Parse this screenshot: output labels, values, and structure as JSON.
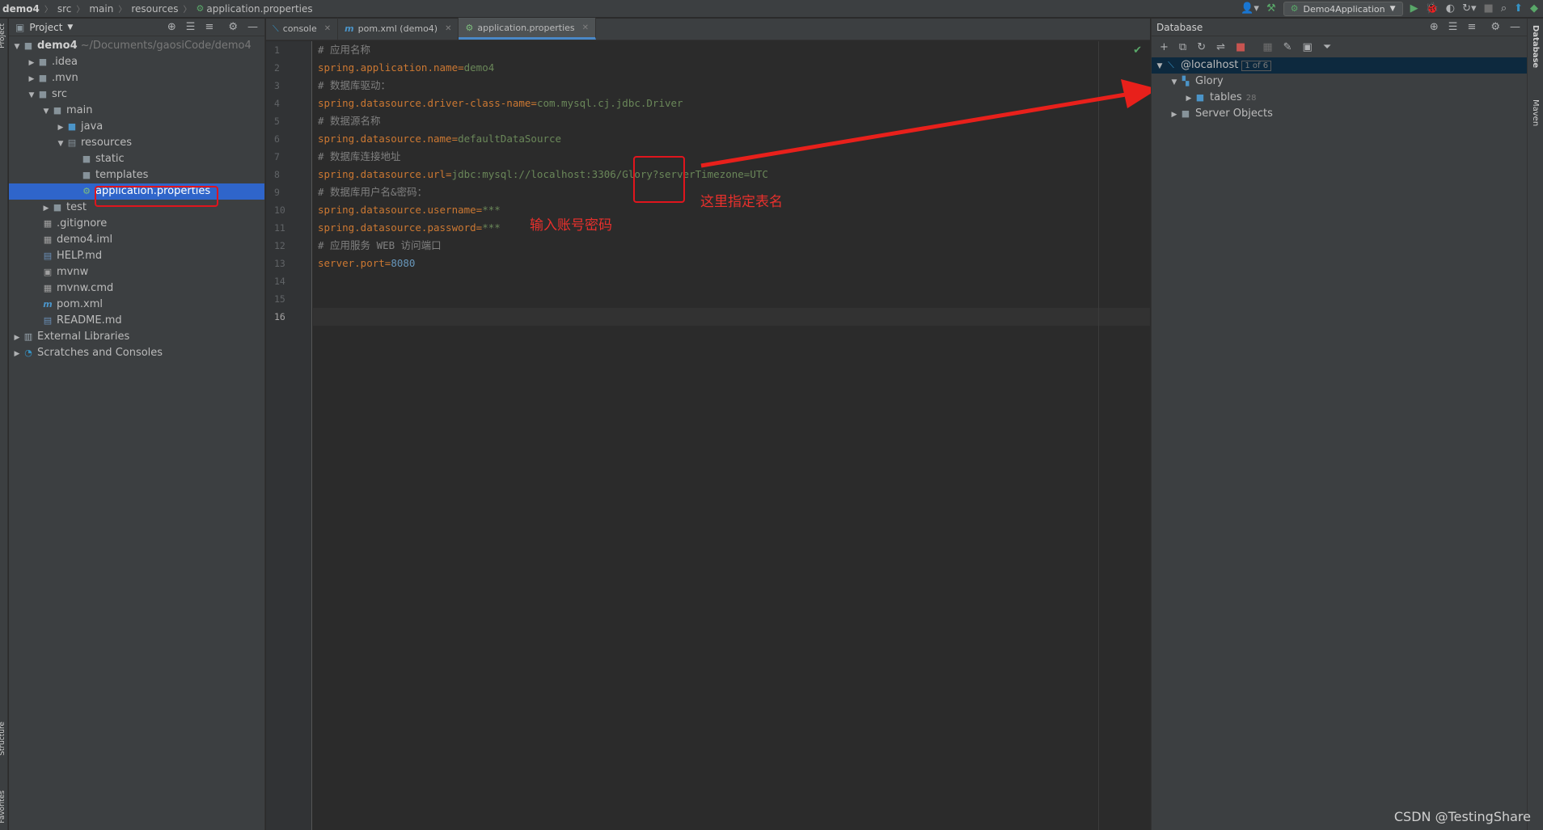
{
  "breadcrumb": [
    "demo4",
    "src",
    "main",
    "resources",
    "application.properties"
  ],
  "toolbar": {
    "run_config": "Demo4Application"
  },
  "left_strip": {
    "project_tab": "Project",
    "structure_tab": "Structure",
    "favorites_tab": "Favorites"
  },
  "right_strip": {
    "database_tab": "Database",
    "maven_tab": "Maven"
  },
  "project_panel": {
    "title": "Project",
    "root_name": "demo4",
    "root_path": "~/Documents/gaosiCode/demo4",
    "items": {
      "idea": ".idea",
      "mvn": ".mvn",
      "src": "src",
      "main": "main",
      "java": "java",
      "resources": "resources",
      "static": "static",
      "templates": "templates",
      "application_properties": "application.properties",
      "test": "test",
      "gitignore": ".gitignore",
      "demo4_iml": "demo4.iml",
      "help_md": "HELP.md",
      "mvnw": "mvnw",
      "mvnw_cmd": "mvnw.cmd",
      "pom_xml": "pom.xml",
      "readme_md": "README.md",
      "external_libraries": "External Libraries",
      "scratches": "Scratches and Consoles"
    }
  },
  "editor_tabs": [
    "console",
    "pom.xml (demo4)",
    "application.properties"
  ],
  "line_numbers": [
    "1",
    "2",
    "3",
    "4",
    "5",
    "6",
    "7",
    "8",
    "9",
    "10",
    "11",
    "12",
    "13",
    "14",
    "15",
    "16"
  ],
  "code": {
    "l1": "# 应用名称",
    "l2_key": "spring.application.name",
    "l2_val": "demo4",
    "l3": "# 数据库驱动：",
    "l4_key": "spring.datasource.driver-class-name",
    "l4_val": "com.mysql.cj.jdbc.Driver",
    "l5": "# 数据源名称",
    "l6_key": "spring.datasource.name",
    "l6_val": "defaultDataSource",
    "l7": "# 数据库连接地址",
    "l8_key": "spring.datasource.url",
    "l8_val": "jdbc:mysql://localhost:3306/Glory?serverTimezone=UTC",
    "l9": "# 数据库用户名&密码：",
    "l10_key": "spring.datasource.username",
    "l10_val": "***",
    "l11_key": "spring.datasource.password",
    "l11_val": "***",
    "l12": "# 应用服务 WEB 访问端口",
    "l13_key": "server.port",
    "l13_val": "8080",
    "eq": "="
  },
  "annotations": {
    "table_name_note": "这里指定表名",
    "account_note": "输入账号密码"
  },
  "database_panel": {
    "title": "Database",
    "host": "@localhost",
    "host_badge": "1 of 6",
    "schema": "Glory",
    "tables": "tables",
    "tables_count": "28",
    "server_objects": "Server Objects"
  },
  "watermark": "CSDN @TestingShare"
}
